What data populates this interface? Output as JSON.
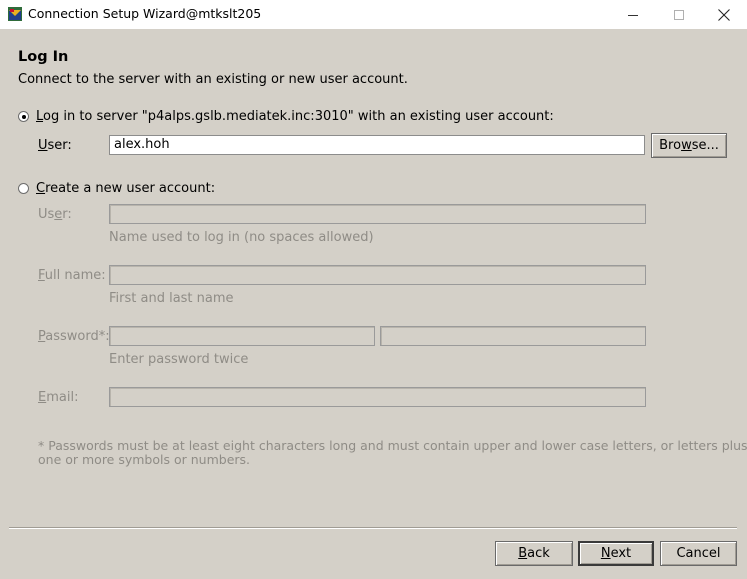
{
  "window": {
    "title": "Connection Setup Wizard@mtkslt205",
    "icon": "p4v-app-icon",
    "controls": [
      "minimize-icon",
      "maximize-icon",
      "close-icon"
    ]
  },
  "page": {
    "heading": "Log In",
    "subtitle": "Connect to the server with an existing or new user account."
  },
  "existing": {
    "radio_label_pre": "",
    "radio_label_key": "L",
    "radio_label_post": "og in to server \"p4alps.gslb.mediatek.inc:3010\" with an existing user account:",
    "selected": true,
    "user_label_key": "U",
    "user_label_post": "ser:",
    "user_value": "alex.hoh",
    "browse_pre": "Bro",
    "browse_key": "w",
    "browse_post": "se..."
  },
  "create": {
    "radio_label_key": "C",
    "radio_label_post": "reate a new user account:",
    "selected": false,
    "user_label_pre": "Us",
    "user_label_key": "e",
    "user_label_post": "r:",
    "user_hint": "Name used to log in (no spaces allowed)",
    "fullname_label_key": "F",
    "fullname_label_post": "ull name:",
    "fullname_hint": "First and last name",
    "password_label_key": "P",
    "password_label_post": "assword*:",
    "password_hint": "Enter password twice",
    "email_label_key": "E",
    "email_label_post": "mail:",
    "footnote_line1": "* Passwords must be at least eight characters long and must contain upper and lower case letters, or letters plus",
    "footnote_line2": "one or more symbols or numbers."
  },
  "buttons": {
    "back_key": "B",
    "back_post": "ack",
    "next_key": "N",
    "next_post": "ext",
    "cancel": "Cancel"
  }
}
